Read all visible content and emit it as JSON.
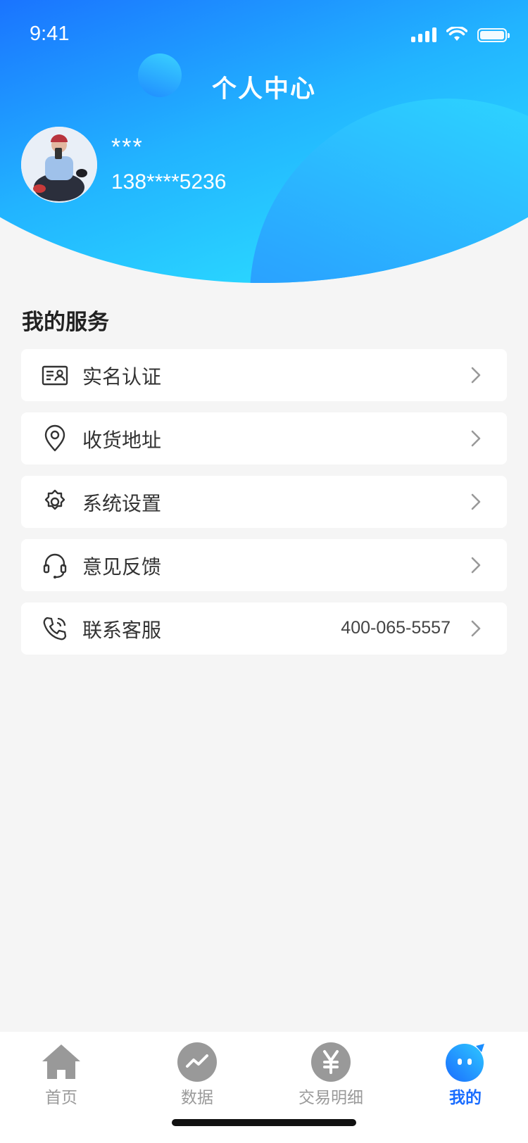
{
  "status_bar": {
    "time": "9:41"
  },
  "header": {
    "title": "个人中心",
    "user_name": "***",
    "phone": "138****5236"
  },
  "services": {
    "title": "我的服务",
    "items": [
      {
        "label": "实名认证",
        "icon": "id-card-icon",
        "value": ""
      },
      {
        "label": "收货地址",
        "icon": "location-pin-icon",
        "value": ""
      },
      {
        "label": "系统设置",
        "icon": "gear-icon",
        "value": ""
      },
      {
        "label": "意见反馈",
        "icon": "headset-icon",
        "value": ""
      },
      {
        "label": "联系客服",
        "icon": "phone-icon",
        "value": "400-065-5557"
      }
    ]
  },
  "tabbar": {
    "items": [
      {
        "label": "首页",
        "icon": "home-icon",
        "active": false
      },
      {
        "label": "数据",
        "icon": "chart-icon",
        "active": false
      },
      {
        "label": "交易明细",
        "icon": "yen-icon",
        "active": false
      },
      {
        "label": "我的",
        "icon": "profile-bubble-icon",
        "active": true
      }
    ]
  },
  "colors": {
    "accent": "#1a6dff",
    "header_gradient_start": "#1a74ff",
    "header_gradient_end": "#2ee8ff",
    "page_bg": "#f5f5f5",
    "tab_inactive": "#9a9a9a"
  }
}
